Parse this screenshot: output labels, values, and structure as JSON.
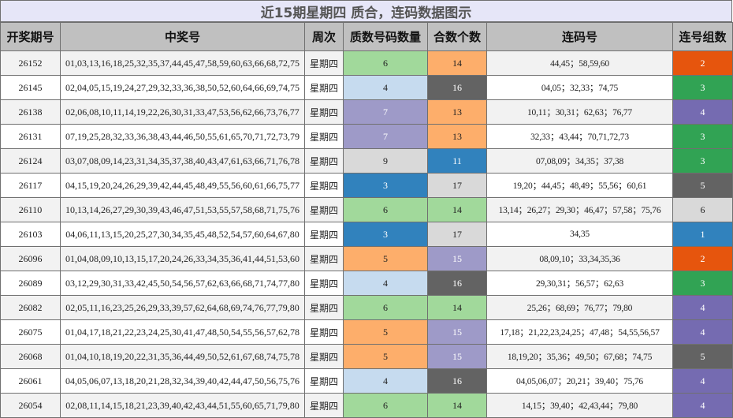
{
  "title": "近15期星期四 质合，连码数据图示",
  "headers": [
    "开奖期号",
    "中奖号",
    "周次",
    "质数号码数量",
    "合数个数",
    "连码号",
    "连号组数"
  ],
  "colors": {
    "green": "#a1d99b",
    "light_blue": "#c6dbef",
    "purple": "#9e9ac8",
    "orange": "#fdae6b",
    "gray_light": "#d9d9d9",
    "blue": "#3182bd",
    "dark_gray": "#636363",
    "dark_orange": "#e6550d",
    "dark_green": "#31a354",
    "dark_purple": "#756bb1"
  },
  "rows": [
    {
      "issue": "26152",
      "numbers": "01,03,13,16,18,25,32,35,37,44,45,47,58,59,60,63,66,68,72,75",
      "week": "星期四",
      "primes": "6",
      "primes_color": "green",
      "composites": "14",
      "composites_color": "orange",
      "consecutive": "44,45；58,59,60",
      "groups": "2",
      "groups_color": "dark_orange"
    },
    {
      "issue": "26145",
      "numbers": "02,04,05,15,19,24,27,29,32,33,36,38,50,52,60,64,66,69,74,75",
      "week": "星期四",
      "primes": "4",
      "primes_color": "light_blue",
      "composites": "16",
      "composites_color": "dark_gray",
      "consecutive": "04,05；32,33；74,75",
      "groups": "3",
      "groups_color": "dark_green"
    },
    {
      "issue": "26138",
      "numbers": "02,06,08,10,11,14,19,22,26,30,31,33,47,53,56,62,66,73,76,77",
      "week": "星期四",
      "primes": "7",
      "primes_color": "purple",
      "composites": "13",
      "composites_color": "orange",
      "consecutive": "10,11；30,31；62,63；76,77",
      "groups": "4",
      "groups_color": "dark_purple"
    },
    {
      "issue": "26131",
      "numbers": "07,19,25,28,32,33,36,38,43,44,46,50,55,61,65,70,71,72,73,79",
      "week": "星期四",
      "primes": "7",
      "primes_color": "purple",
      "composites": "13",
      "composites_color": "orange",
      "consecutive": "32,33；43,44；70,71,72,73",
      "groups": "3",
      "groups_color": "dark_green"
    },
    {
      "issue": "26124",
      "numbers": "03,07,08,09,14,23,31,34,35,37,38,40,43,47,61,63,66,71,76,78",
      "week": "星期四",
      "primes": "9",
      "primes_color": "gray_light",
      "composites": "11",
      "composites_color": "blue",
      "consecutive": "07,08,09；34,35；37,38",
      "groups": "3",
      "groups_color": "dark_green"
    },
    {
      "issue": "26117",
      "numbers": "04,15,19,20,24,26,29,39,42,44,45,48,49,55,56,60,61,66,75,77",
      "week": "星期四",
      "primes": "3",
      "primes_color": "blue",
      "composites": "17",
      "composites_color": "gray_light",
      "consecutive": "19,20；44,45；48,49；55,56；60,61",
      "groups": "5",
      "groups_color": "dark_gray"
    },
    {
      "issue": "26110",
      "numbers": "10,13,14,26,27,29,30,39,43,46,47,51,53,55,57,58,68,71,75,76",
      "week": "星期四",
      "primes": "6",
      "primes_color": "green",
      "composites": "14",
      "composites_color": "green",
      "consecutive": "13,14；26,27；29,30；46,47；57,58；75,76",
      "groups": "6",
      "groups_color": "gray_light"
    },
    {
      "issue": "26103",
      "numbers": "04,06,11,13,15,20,25,27,30,34,35,45,48,52,54,57,60,64,67,80",
      "week": "星期四",
      "primes": "3",
      "primes_color": "blue",
      "composites": "17",
      "composites_color": "gray_light",
      "consecutive": "34,35",
      "groups": "1",
      "groups_color": "blue"
    },
    {
      "issue": "26096",
      "numbers": "01,04,08,09,10,13,15,17,20,24,26,33,34,35,36,41,44,51,53,60",
      "week": "星期四",
      "primes": "5",
      "primes_color": "orange",
      "composites": "15",
      "composites_color": "purple",
      "consecutive": "08,09,10；33,34,35,36",
      "groups": "2",
      "groups_color": "dark_orange"
    },
    {
      "issue": "26089",
      "numbers": "03,12,29,30,31,33,42,45,50,54,56,57,62,63,66,68,71,74,77,80",
      "week": "星期四",
      "primes": "4",
      "primes_color": "light_blue",
      "composites": "16",
      "composites_color": "dark_gray",
      "consecutive": "29,30,31；56,57；62,63",
      "groups": "3",
      "groups_color": "dark_green"
    },
    {
      "issue": "26082",
      "numbers": "02,05,11,16,23,25,26,29,33,39,57,62,64,68,69,74,76,77,79,80",
      "week": "星期四",
      "primes": "6",
      "primes_color": "green",
      "composites": "14",
      "composites_color": "green",
      "consecutive": "25,26；68,69；76,77；79,80",
      "groups": "4",
      "groups_color": "dark_purple"
    },
    {
      "issue": "26075",
      "numbers": "01,04,17,18,21,22,23,24,25,30,41,47,48,50,54,55,56,57,62,78",
      "week": "星期四",
      "primes": "5",
      "primes_color": "orange",
      "composites": "15",
      "composites_color": "purple",
      "consecutive": "17,18；21,22,23,24,25；47,48；54,55,56,57",
      "groups": "4",
      "groups_color": "dark_purple"
    },
    {
      "issue": "26068",
      "numbers": "01,04,10,18,19,20,22,31,35,36,44,49,50,52,61,67,68,74,75,78",
      "week": "星期四",
      "primes": "5",
      "primes_color": "orange",
      "composites": "15",
      "composites_color": "purple",
      "consecutive": "18,19,20；35,36；49,50；67,68；74,75",
      "groups": "5",
      "groups_color": "dark_gray"
    },
    {
      "issue": "26061",
      "numbers": "04,05,06,07,13,18,20,21,28,32,34,39,40,42,44,47,50,56,75,76",
      "week": "星期四",
      "primes": "4",
      "primes_color": "light_blue",
      "composites": "16",
      "composites_color": "dark_gray",
      "consecutive": "04,05,06,07；20,21；39,40；75,76",
      "groups": "4",
      "groups_color": "dark_purple"
    },
    {
      "issue": "26054",
      "numbers": "02,08,11,14,15,18,21,23,39,40,42,43,44,51,55,60,65,71,79,80",
      "week": "星期四",
      "primes": "6",
      "primes_color": "green",
      "composites": "14",
      "composites_color": "green",
      "consecutive": "14,15；39,40；42,43,44；79,80",
      "groups": "4",
      "groups_color": "dark_purple"
    }
  ]
}
